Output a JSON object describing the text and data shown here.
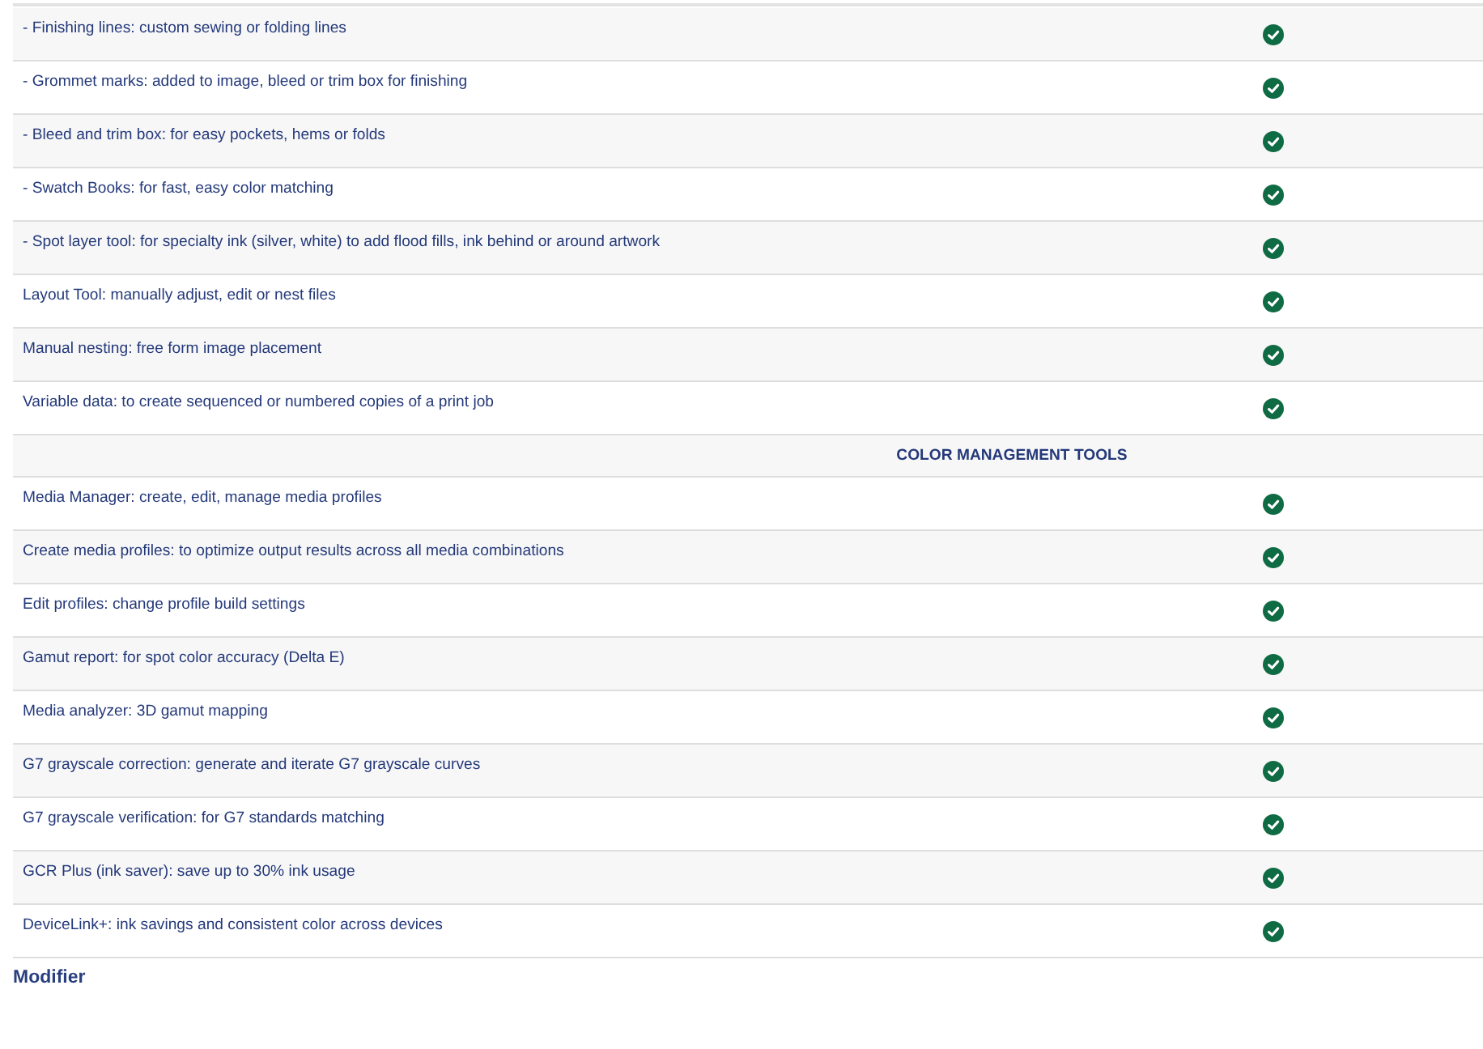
{
  "table": {
    "rows": [
      {
        "kind": "feature",
        "label": "- Finishing lines: custom sewing or folding lines",
        "included": true
      },
      {
        "kind": "feature",
        "label": "- Grommet marks: added to image, bleed or trim box for finishing",
        "included": true
      },
      {
        "kind": "feature",
        "label": "- Bleed and trim box: for easy pockets, hems or folds",
        "included": true
      },
      {
        "kind": "feature",
        "label": "- Swatch Books: for fast, easy color matching",
        "included": true
      },
      {
        "kind": "feature",
        "label": "- Spot layer tool: for specialty ink (silver, white) to add flood fills, ink behind or around artwork",
        "included": true
      },
      {
        "kind": "feature",
        "label": "Layout Tool: manually adjust, edit or nest files",
        "included": true
      },
      {
        "kind": "feature",
        "label": "Manual nesting: free form image placement",
        "included": true
      },
      {
        "kind": "feature",
        "label": "Variable data: to create sequenced or numbered copies of a print job",
        "included": true
      },
      {
        "kind": "section",
        "label": "COLOR MANAGEMENT TOOLS"
      },
      {
        "kind": "feature",
        "label": "Media Manager: create, edit, manage media profiles",
        "included": true
      },
      {
        "kind": "feature",
        "label": "Create media profiles: to optimize output results across all media combinations",
        "included": true
      },
      {
        "kind": "feature",
        "label": "Edit profiles: change profile build settings",
        "included": true
      },
      {
        "kind": "feature",
        "label": "Gamut report: for spot color accuracy (Delta E)",
        "included": true
      },
      {
        "kind": "feature",
        "label": "Media analyzer: 3D gamut mapping",
        "included": true
      },
      {
        "kind": "feature",
        "label": "G7 grayscale correction: generate and iterate G7 grayscale curves",
        "included": true
      },
      {
        "kind": "feature",
        "label": "G7 grayscale verification: for G7 standards matching",
        "included": true
      },
      {
        "kind": "feature",
        "label": "GCR Plus (ink saver): save up to 30% ink usage",
        "included": true
      },
      {
        "kind": "feature",
        "label": "DeviceLink+: ink savings and consistent color across devices",
        "included": true
      }
    ]
  },
  "heading": "Modifier"
}
